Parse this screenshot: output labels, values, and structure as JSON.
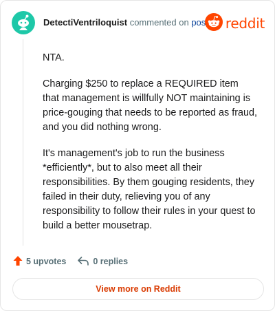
{
  "comment": {
    "author": "DetectiVentriloquist",
    "action_text": "commented on",
    "post_link": "post",
    "paragraphs": [
      "NTA.",
      "Charging $250 to replace a REQUIRED item that management is willfully NOT maintaining is price-gouging that needs to be reported as fraud, and you did nothing wrong.",
      "It's management's job to run the business *efficiently*, but to also meet all their responsibilities. By them gouging residents, they failed in their duty, relieving you of any responsibility to follow their rules in your quest to build a better mousetrap."
    ]
  },
  "brand": {
    "logo_text": "reddit",
    "color": "#ff4500"
  },
  "actions": {
    "upvotes": "5 upvotes",
    "replies": "0 replies"
  },
  "footer": {
    "view_more": "View more on Reddit"
  },
  "colors": {
    "avatar": "#1ec8a8",
    "upvote": "#ff4500",
    "link": "#0a449b",
    "cta": "#d93a00"
  },
  "icons": {
    "avatar": "snoo-avatar-icon",
    "upvote": "upvote-arrow-icon",
    "reply": "reply-arrow-icon",
    "logo": "reddit-snoo-icon"
  }
}
